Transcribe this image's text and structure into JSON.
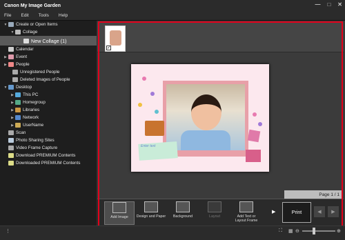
{
  "window": {
    "title": "Canon My Image Garden",
    "minimize": "—",
    "maximize": "□",
    "close": "✕"
  },
  "menu": [
    "File",
    "Edit",
    "Tools",
    "Help"
  ],
  "sidebar": {
    "items": [
      {
        "label": "Create or Open Items",
        "arrow": "▼",
        "icon": "create-icon"
      },
      {
        "label": "Collage",
        "arrow": "▼",
        "icon": "collage-icon"
      },
      {
        "label": "New Collage (1)",
        "arrow": "",
        "icon": "new-collage-icon",
        "selected": true
      },
      {
        "label": "Calendar",
        "arrow": "",
        "icon": "calendar-icon"
      },
      {
        "label": "Event",
        "arrow": "▶",
        "icon": "event-icon"
      },
      {
        "label": "People",
        "arrow": "▶",
        "icon": "people-icon"
      },
      {
        "label": "Unregistered People",
        "arrow": "",
        "icon": "unregistered-people-icon"
      },
      {
        "label": "Deleted Images of People",
        "arrow": "",
        "icon": "deleted-images-icon"
      },
      {
        "label": "Desktop",
        "arrow": "▼",
        "icon": "desktop-icon"
      },
      {
        "label": "This PC",
        "arrow": "▶",
        "icon": "pc-icon"
      },
      {
        "label": "Homegroup",
        "arrow": "▶",
        "icon": "homegroup-icon"
      },
      {
        "label": "Libraries",
        "arrow": "▶",
        "icon": "libraries-icon"
      },
      {
        "label": "Network",
        "arrow": "▶",
        "icon": "network-icon"
      },
      {
        "label": "UserName",
        "arrow": "▶",
        "icon": "user-icon"
      },
      {
        "label": "Scan",
        "arrow": "",
        "icon": "scan-icon"
      },
      {
        "label": "Photo Sharing Sites",
        "arrow": "",
        "icon": "photo-sharing-icon"
      },
      {
        "label": "Video Frame Capture",
        "arrow": "",
        "icon": "video-capture-icon"
      },
      {
        "label": "Download PREMIUM Contents",
        "arrow": "",
        "icon": "download-icon"
      },
      {
        "label": "Downloaded PREMIUM Contents",
        "arrow": "",
        "icon": "downloaded-icon"
      }
    ]
  },
  "canvas": {
    "note_text": "Enter text"
  },
  "page_indicator": "Page 1 / 1",
  "toolbar": {
    "tools": [
      {
        "label": "Add Image",
        "icon": "add-image-icon",
        "state": "active"
      },
      {
        "label": "Design and Paper",
        "icon": "design-paper-icon",
        "state": "normal"
      },
      {
        "label": "Background",
        "icon": "background-icon",
        "state": "normal"
      },
      {
        "label": "Layout",
        "icon": "layout-icon",
        "state": "disabled"
      },
      {
        "label": "Add Text or Layout Frame",
        "icon": "add-text-icon",
        "state": "normal"
      }
    ],
    "next_label": "▶",
    "print_label": "Print",
    "prev_arrow": "◀",
    "next_arrow": "▶"
  },
  "colors": {
    "highlight_frame": "#e4001b",
    "selected_bg": "#5a5a5a"
  }
}
